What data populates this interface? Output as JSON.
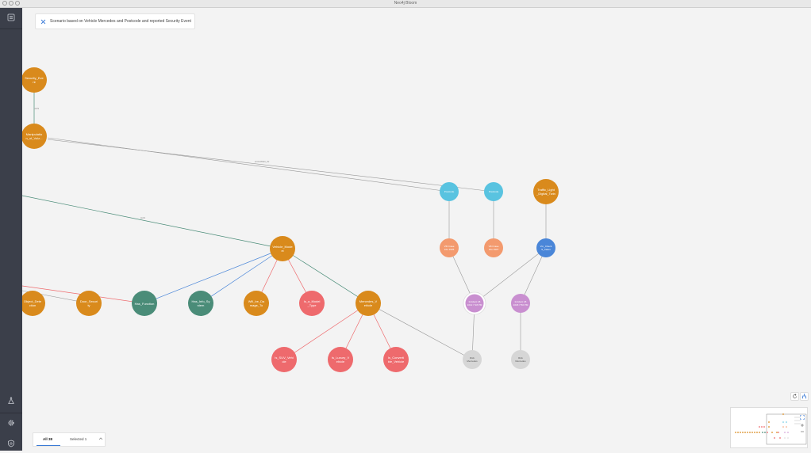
{
  "window": {
    "title": "Neo4j Bloom"
  },
  "scenario": {
    "text": "Scenario based on Vehicle Mercedes and Postcode and reported Security Event"
  },
  "sidebar": {
    "items": [
      {
        "icon": "panel-icon"
      },
      {
        "icon": "flask-icon"
      },
      {
        "icon": "gear-icon"
      },
      {
        "icon": "shield-icon"
      }
    ]
  },
  "bottom_tabs": {
    "all_label": "All 38",
    "selected_label": "Selected 1"
  },
  "colors": {
    "orange": "#d98a1c",
    "red": "#ee6a6d",
    "green": "#4a8c78",
    "teal": "#59c3e0",
    "salmon": "#f39a6e",
    "blue": "#4a86d8",
    "purple": "#c98fd0",
    "gray": "#d6d6d6"
  },
  "graph": {
    "nodes": [
      {
        "id": "security_event",
        "lines": [
          "Security_Eve",
          "nt"
        ],
        "color": "orange"
      },
      {
        "id": "manipulation",
        "lines": [
          "Manipulatio",
          "n_of_Vulz..."
        ],
        "color": "orange"
      },
      {
        "id": "vehicle_model",
        "lines": [
          "Vehicle_Mode",
          "el"
        ],
        "color": "orange"
      },
      {
        "id": "object_detection",
        "lines": [
          "Object_Dete",
          "ction"
        ],
        "color": "orange"
      },
      {
        "id": "door_security",
        "lines": [
          "Door_Securi",
          "ty"
        ],
        "color": "orange"
      },
      {
        "id": "has_function",
        "lines": [
          "Has_Function"
        ],
        "color": "green"
      },
      {
        "id": "has_info_system",
        "lines": [
          "Has_Info_Sy",
          "stem"
        ],
        "color": "green"
      },
      {
        "id": "will_be_damage",
        "lines": [
          "Will_be_Da",
          "mage_To"
        ],
        "color": "orange"
      },
      {
        "id": "is_a_model_type",
        "lines": [
          "Is_a_Model",
          "_Type"
        ],
        "color": "red"
      },
      {
        "id": "mercedes_vehicle",
        "lines": [
          "Mercedes_V",
          "ehicle"
        ],
        "color": "orange"
      },
      {
        "id": "is_suv",
        "lines": [
          "Is_SUV_Vehi",
          "cle"
        ],
        "color": "red"
      },
      {
        "id": "is_luxury",
        "lines": [
          "Is_Luxury_V",
          "ehicle"
        ],
        "color": "red"
      },
      {
        "id": "is_convertible",
        "lines": [
          "Is_Converti",
          "ble_Vehicle"
        ],
        "color": "red"
      },
      {
        "id": "teal_1",
        "lines": [
          "Postcode"
        ],
        "color": "teal"
      },
      {
        "id": "teal_2",
        "lines": [
          "Postcode"
        ],
        "color": "teal"
      },
      {
        "id": "traffic_lights",
        "lines": [
          "Traffic_Light",
          "_Digital_Twin"
        ],
        "color": "orange"
      },
      {
        "id": "salmon_1",
        "lines": [
          "VIN Case",
          "Info 1935"
        ],
        "color": "salmon"
      },
      {
        "id": "salmon_2",
        "lines": [
          "VIN Case",
          "Info 1937"
        ],
        "color": "salmon"
      },
      {
        "id": "blue_1",
        "lines": [
          "Vm_Check",
          "S_Taken"
        ],
        "color": "blue"
      },
      {
        "id": "purple_1",
        "lines": [
          "Incident 18",
          "1012 7:18 PM"
        ],
        "color": "purple"
      },
      {
        "id": "purple_2",
        "lines": [
          "Incident 18",
          "1018 7:50 PM"
        ],
        "color": "purple"
      },
      {
        "id": "gray_1",
        "lines": [
          "Rick",
          "Mercedes"
        ],
        "color": "gray"
      },
      {
        "id": "gray_2",
        "lines": [
          "Rick",
          "Mercedes"
        ],
        "color": "gray"
      }
    ]
  }
}
